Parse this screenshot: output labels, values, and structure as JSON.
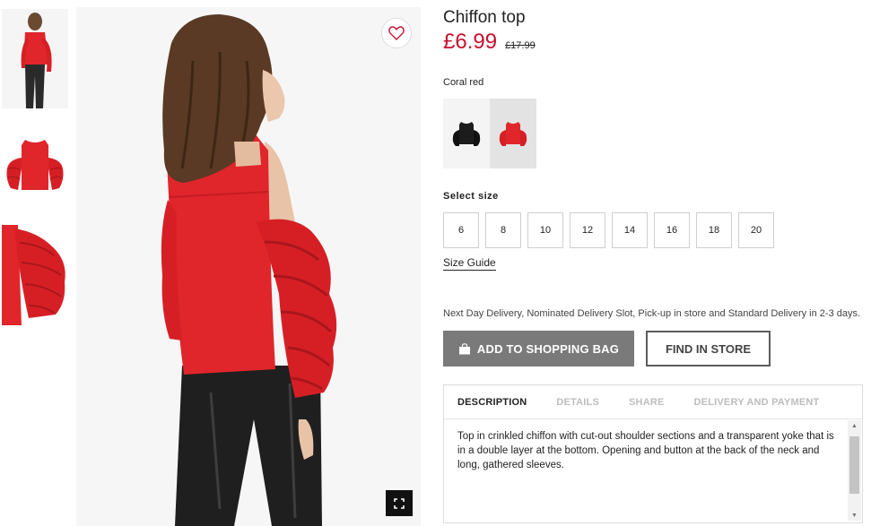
{
  "product": {
    "title": "Chiffon top",
    "price": "£6.99",
    "old_price": "£17.99",
    "color_name": "Coral red"
  },
  "colors": {
    "accent_price": "#c8102e",
    "garment_red": "#e0262b",
    "button_grey": "#7a7a7a"
  },
  "swatches": [
    {
      "name": "Black",
      "selected": false
    },
    {
      "name": "Coral red",
      "selected": true
    }
  ],
  "size_section": {
    "label": "Select size",
    "sizes": [
      "6",
      "8",
      "10",
      "12",
      "14",
      "16",
      "18",
      "20"
    ],
    "guide_label": "Size Guide"
  },
  "delivery_text": "Next Day Delivery, Nominated Delivery Slot, Pick-up in store and Standard Delivery in 2-3 days.",
  "actions": {
    "add_to_bag": "ADD TO SHOPPING BAG",
    "find_in_store": "FIND IN STORE"
  },
  "tabs": [
    {
      "label": "DESCRIPTION",
      "active": true
    },
    {
      "label": "DETAILS",
      "active": false
    },
    {
      "label": "SHARE",
      "active": false
    },
    {
      "label": "DELIVERY AND PAYMENT",
      "active": false
    }
  ],
  "description": "Top in crinkled chiffon with cut-out shoulder sections and a transparent yoke that is in a double layer at the bottom. Opening and button at the back of the neck and long, gathered sleeves.",
  "icons": {
    "favorite": "heart-icon",
    "zoom": "expand-icon",
    "bag": "shopping-bag-icon"
  }
}
